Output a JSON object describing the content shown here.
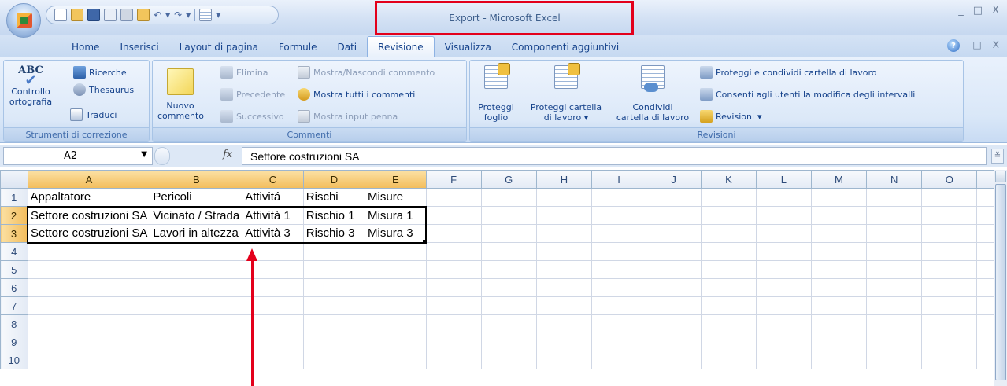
{
  "window": {
    "title": "Export - Microsoft Excel",
    "controls": [
      "_",
      "□",
      "X"
    ],
    "inner_controls": [
      "_",
      "□",
      "X"
    ]
  },
  "tabs": [
    "Home",
    "Inserisci",
    "Layout di pagina",
    "Formule",
    "Dati",
    "Revisione",
    "Visualizza",
    "Componenti aggiuntivi"
  ],
  "active_tab": "Revisione",
  "ribbon": {
    "proofing": {
      "label": "Strumenti di correzione",
      "spell_icon": "ABC",
      "spell_line1": "Controllo",
      "spell_line2": "ortografia",
      "research": "Ricerche",
      "thesaurus": "Thesaurus",
      "translate": "Traduci"
    },
    "comments": {
      "label": "Commenti",
      "new_line1": "Nuovo",
      "new_line2": "commento",
      "delete": "Elimina",
      "previous": "Precedente",
      "next": "Successivo",
      "show_hide": "Mostra/Nascondi commento",
      "show_all": "Mostra tutti i commenti",
      "show_ink": "Mostra input penna"
    },
    "changes": {
      "label": "Revisioni",
      "protect_sheet_line1": "Proteggi",
      "protect_sheet_line2": "foglio",
      "protect_wb_line1": "Proteggi cartella",
      "protect_wb_line2": "di lavoro",
      "share_line1": "Condividi",
      "share_line2": "cartella di lavoro",
      "protect_share": "Proteggi e condividi cartella di lavoro",
      "allow_edit": "Consenti agli utenti la modifica degli intervalli",
      "track": "Revisioni"
    }
  },
  "formula_bar": {
    "name_box": "A2",
    "fx": "fx",
    "content": "Settore costruzioni SA"
  },
  "sheet": {
    "columns": [
      "A",
      "B",
      "C",
      "D",
      "E",
      "F",
      "G",
      "H",
      "I",
      "J",
      "K",
      "L",
      "M",
      "N",
      "O"
    ],
    "rows": [
      [
        "1",
        "Appaltatore",
        "Pericoli",
        "Attivitá",
        "Rischi",
        "Misure"
      ],
      [
        "2",
        "Settore costruzioni SA",
        "Vicinato / Strada",
        "Attività 1",
        "Rischio 1",
        "Misura 1"
      ],
      [
        "3",
        "Settore costruzioni SA",
        "Lavori in altezza",
        "Attività 3",
        "Rischio 3",
        "Misura 3"
      ],
      [
        "4"
      ],
      [
        "5"
      ],
      [
        "6"
      ],
      [
        "7"
      ],
      [
        "8"
      ],
      [
        "9"
      ],
      [
        "10"
      ]
    ]
  },
  "colors": {
    "highlight": "#e3001b",
    "selected_header": "#f3bd5c",
    "ribbon_text": "#15428b"
  }
}
